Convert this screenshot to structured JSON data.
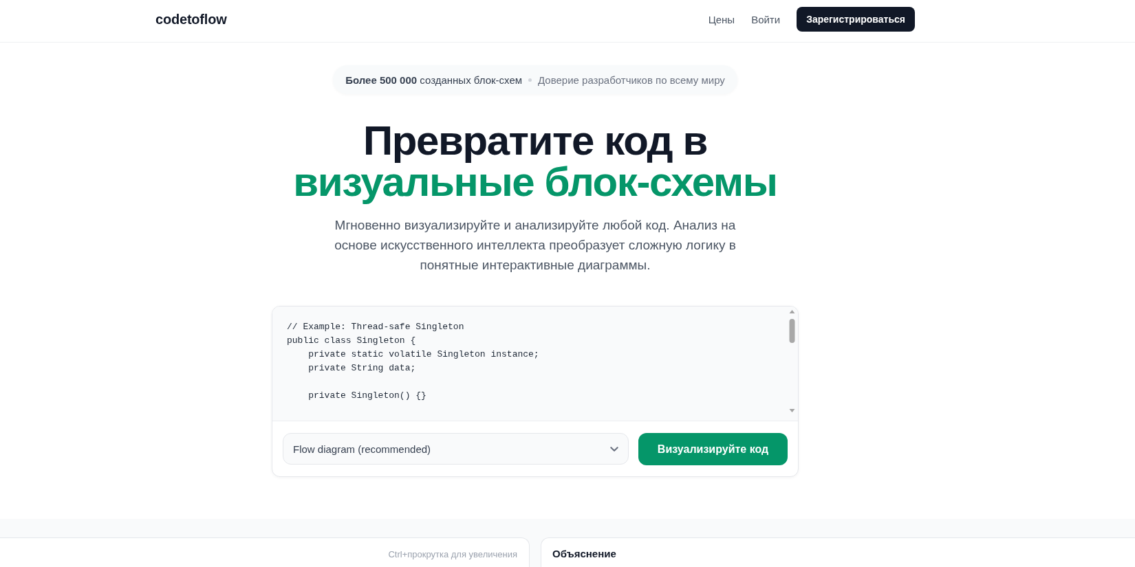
{
  "header": {
    "logo": "codetoflow",
    "nav": [
      "Цены",
      "Войти"
    ],
    "cta": "Зарегистрироваться"
  },
  "badge": {
    "stat": "**Более 500 000** созданных блок-схем",
    "trust": "Доверие разработчиков по всему миру"
  },
  "hero": {
    "title": "Превратите код в",
    "title_highlight": "визуальные блок-схемы",
    "subtitle": "Мгновенно визуализируйте и анализируйте любой код. Анализ на основе искусственного интеллекта преобразует сложную логику в понятные интерактивные диаграммы."
  },
  "editor": {
    "code": "// Example: Thread-safe Singleton\npublic class Singleton {\n    private static volatile Singleton instance;\n    private String data;\n\n    private Singleton() {}",
    "diagram_type": "Flow diagram (recommended)",
    "submit": "Визуализируйте код"
  },
  "panels": [
    {
      "kind": "preview",
      "text": "Ctrl+прокрутка для увеличения"
    },
    {
      "kind": "explanation",
      "text": "Объяснение"
    }
  ]
}
